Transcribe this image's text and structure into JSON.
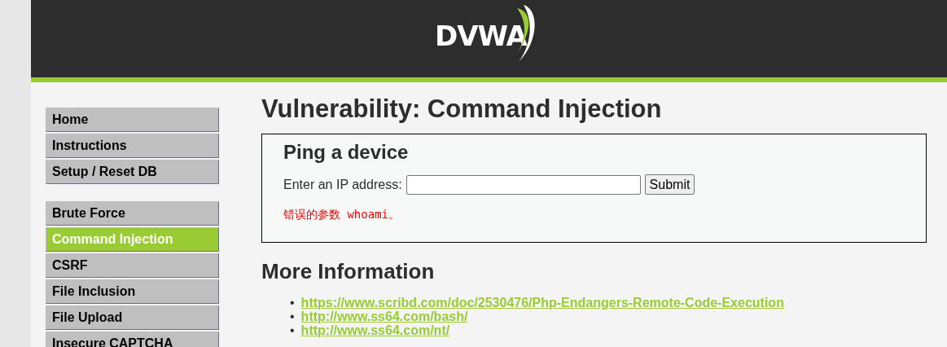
{
  "header": {
    "logo": "DVWA"
  },
  "menu": {
    "groups": [
      [
        {
          "label": "Home",
          "selected": false
        },
        {
          "label": "Instructions",
          "selected": false
        },
        {
          "label": "Setup / Reset DB",
          "selected": false
        }
      ],
      [
        {
          "label": "Brute Force",
          "selected": false
        },
        {
          "label": "Command Injection",
          "selected": true
        },
        {
          "label": "CSRF",
          "selected": false
        },
        {
          "label": "File Inclusion",
          "selected": false
        },
        {
          "label": "File Upload",
          "selected": false
        },
        {
          "label": "Insecure CAPTCHA",
          "selected": false
        }
      ]
    ]
  },
  "main": {
    "title": "Vulnerability: Command Injection",
    "form": {
      "heading": "Ping a device",
      "label": "Enter an IP address:",
      "button": "Submit",
      "error": "错误的参数 whoami。"
    },
    "more_heading": "More Information",
    "links": [
      {
        "bullet": "•",
        "url": "https://www.scribd.com/doc/2530476/Php-Endangers-Remote-Code-Execution"
      },
      {
        "bullet": "•",
        "url": "http://www.ss64.com/bash/"
      },
      {
        "bullet": "•",
        "url": "http://www.ss64.com/nt/"
      }
    ]
  }
}
